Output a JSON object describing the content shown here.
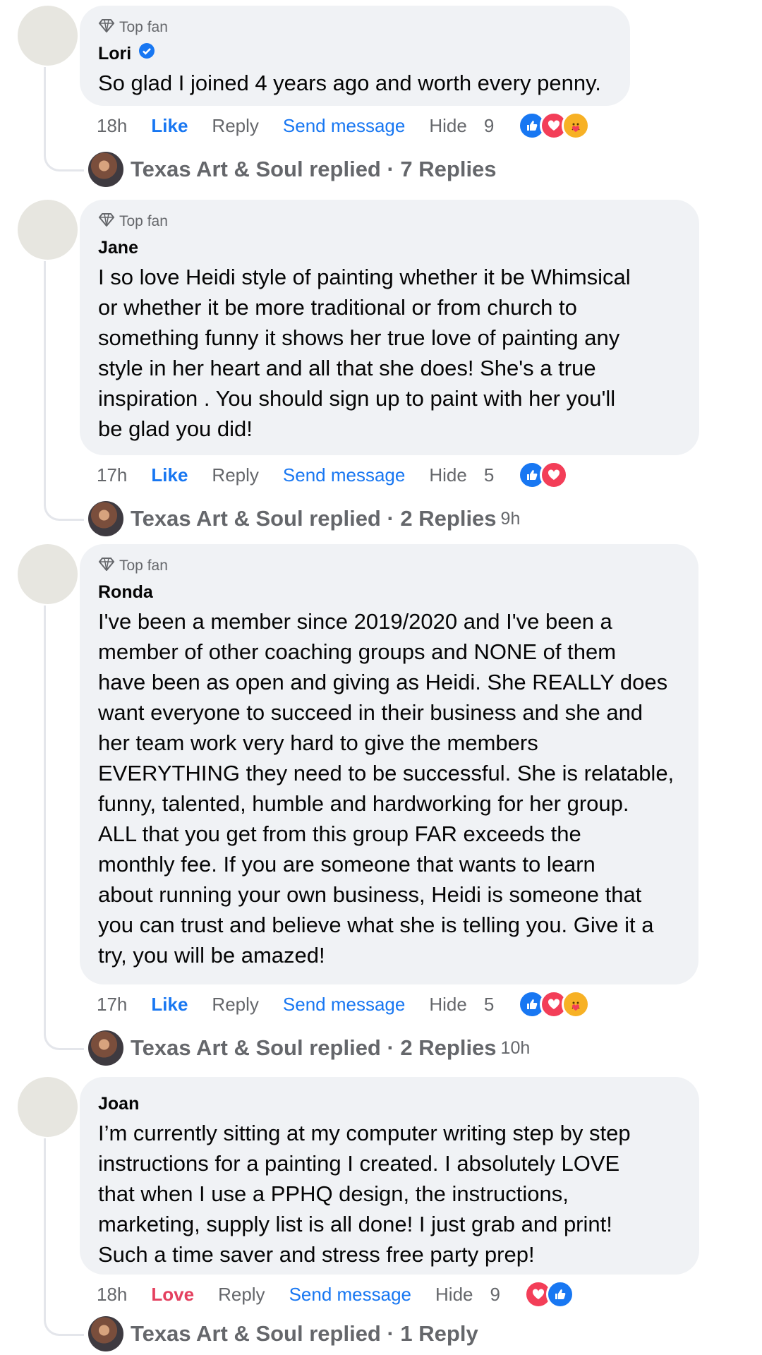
{
  "comments": [
    {
      "badge": "Top fan",
      "author": "Lori",
      "verified": true,
      "text": "So glad I joined 4 years ago and worth every penny.",
      "time": "18h",
      "primary_action": "Like",
      "reply": "Reply",
      "send_message": "Send message",
      "hide": "Hide",
      "reaction_count": "9",
      "reactions": [
        "like-icon",
        "love-icon",
        "care-icon"
      ],
      "replied_text": "Texas Art & Soul replied · 7 Replies",
      "replied_time": ""
    },
    {
      "badge": "Top fan",
      "author": "Jane",
      "verified": false,
      "text": "I so love Heidi style of painting whether it be Whimsical\nor whether it be more traditional or from church to\nsomething funny it shows her true love of painting any\nstyle in her heart and all that she does! She's a true\ninspiration . You should sign up to paint with her you'll\nbe glad you did!",
      "time": "17h",
      "primary_action": "Like",
      "reply": "Reply",
      "send_message": "Send message",
      "hide": "Hide",
      "reaction_count": "5",
      "reactions": [
        "like-icon",
        "love-icon"
      ],
      "replied_text": "Texas Art & Soul replied · 2 Replies",
      "replied_time": "9h"
    },
    {
      "badge": "Top fan",
      "author": "Ronda",
      "verified": false,
      "text": "I've been a member since 2019/2020 and I've been a\nmember of other coaching groups and NONE of them\nhave been as open and giving as Heidi. She REALLY does\nwant everyone to succeed in their business and she and\nher team work very hard to give the members\nEVERYTHING they need to be successful. She is relatable,\nfunny, talented, humble and hardworking for her group.\nALL that you get from this group FAR exceeds the\nmonthly fee. If you are someone that wants to learn\nabout running your own business, Heidi is someone that\nyou can trust and believe what she is telling you. Give it a\ntry, you will be amazed!",
      "time": "17h",
      "primary_action": "Like",
      "reply": "Reply",
      "send_message": "Send message",
      "hide": "Hide",
      "reaction_count": "5",
      "reactions": [
        "like-icon",
        "love-icon",
        "care-icon"
      ],
      "replied_text": "Texas Art & Soul replied · 2 Replies",
      "replied_time": "10h"
    },
    {
      "badge": "",
      "author": "Joan",
      "verified": false,
      "text": "I’m currently sitting at my computer writing step by step\ninstructions for a painting I created. I absolutely LOVE\nthat when I use a PPHQ design, the instructions,\nmarketing, supply list is all done! I just grab and print!\nSuch a time saver and stress free party prep!",
      "time": "18h",
      "primary_action": "Love",
      "reply": "Reply",
      "send_message": "Send message",
      "hide": "Hide",
      "reaction_count": "9",
      "reactions": [
        "love-icon",
        "like-icon"
      ],
      "replied_text": "Texas Art & Soul replied · 1 Reply",
      "replied_time": ""
    }
  ],
  "colors": {
    "link": "#1877f2",
    "love": "#e4405f",
    "bubble": "#f0f2f5",
    "muted": "#65676b"
  }
}
